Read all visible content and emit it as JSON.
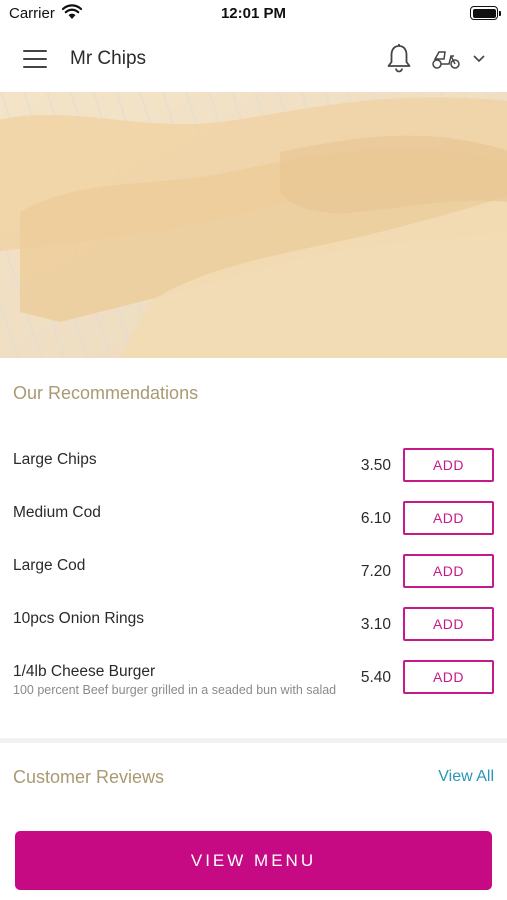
{
  "status_bar": {
    "carrier": "Carrier",
    "time": "12:01 PM"
  },
  "header": {
    "title": "Mr Chips",
    "icons": [
      "menu-icon",
      "bell-icon",
      "scooter-icon",
      "chevron-down-icon"
    ]
  },
  "hero": {
    "image_subject": "fried fish on a wire rack"
  },
  "recommendations": {
    "title": "Our Recommendations",
    "add_label": "ADD",
    "items": [
      {
        "name": "Large Chips",
        "price": "3.50",
        "description": ""
      },
      {
        "name": "Medium Cod",
        "price": "6.10",
        "description": ""
      },
      {
        "name": "Large Cod",
        "price": "7.20",
        "description": ""
      },
      {
        "name": "10pcs Onion Rings",
        "price": "3.10",
        "description": ""
      },
      {
        "name": "1/4lb Cheese Burger",
        "price": "5.40",
        "description": "100 percent Beef burger grilled in a seaded bun with salad"
      }
    ]
  },
  "reviews": {
    "title": "Customer Reviews",
    "view_all": "View All"
  },
  "footer": {
    "view_menu": "VIEW MENU"
  },
  "colors": {
    "accent": "#c60a83",
    "section_title": "#a89a72",
    "link": "#2a96b8"
  }
}
